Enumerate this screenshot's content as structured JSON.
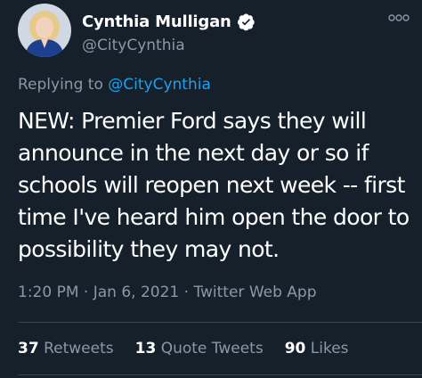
{
  "tweet": {
    "author": {
      "display_name": "Cynthia Mulligan",
      "handle": "@CityCynthia",
      "verified_icon": "verified-badge-icon",
      "avatar_icon": "avatar"
    },
    "reply": {
      "prefix": "Replying to ",
      "handle": "@CityCynthia"
    },
    "text": "NEW: Premier Ford says they will announce in the next day or so if schools will reopen next week -- first time I've heard him open the door to possibility they may not.",
    "meta": {
      "time": "1:20 PM",
      "sep1": " · ",
      "date": "Jan 6, 2021",
      "sep2": " · ",
      "source": "Twitter Web App"
    },
    "stats": {
      "retweets_count": "37",
      "retweets_label": "Retweets",
      "quote_count": "13",
      "quote_label": "Quote Tweets",
      "likes_count": "90",
      "likes_label": "Likes"
    }
  },
  "colors": {
    "background": "#15202b",
    "text": "#ffffff",
    "secondary": "#8899a6",
    "link": "#1da1f2",
    "divider": "#38444d"
  }
}
